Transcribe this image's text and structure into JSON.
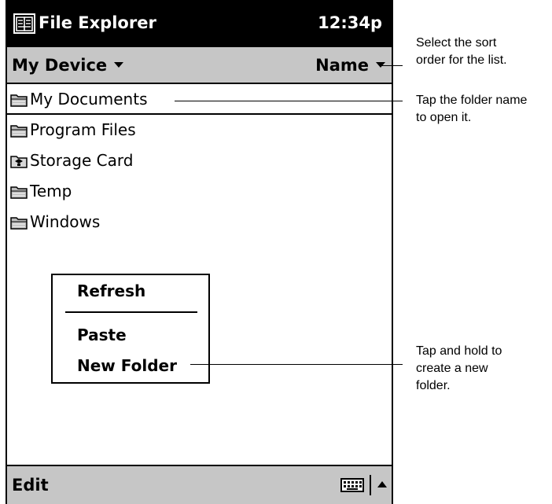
{
  "titlebar": {
    "app_title": "File Explorer",
    "time": "12:34p"
  },
  "navbar": {
    "location": "My Device",
    "sort_by": "Name"
  },
  "files": [
    {
      "name": "My Documents",
      "icon": "folder-icon",
      "selected": true
    },
    {
      "name": "Program Files",
      "icon": "folder-icon"
    },
    {
      "name": "Storage Card",
      "icon": "storage-card-icon"
    },
    {
      "name": "Temp",
      "icon": "folder-icon"
    },
    {
      "name": "Windows",
      "icon": "folder-icon"
    }
  ],
  "context_menu": {
    "items": [
      "Refresh",
      "Paste",
      "New Folder"
    ]
  },
  "bottombar": {
    "edit": "Edit",
    "keyboard_icon": "keyboard-icon",
    "sip_icon": "up-arrow-icon"
  },
  "callouts": {
    "sort": "Select the sort\norder for the list.",
    "open": "Tap the folder name\nto open it.",
    "new_folder": "Tap and hold to\ncreate a new\nfolder."
  },
  "colors": {
    "titlebar": "#000000",
    "bars": "#c6c6c6"
  }
}
